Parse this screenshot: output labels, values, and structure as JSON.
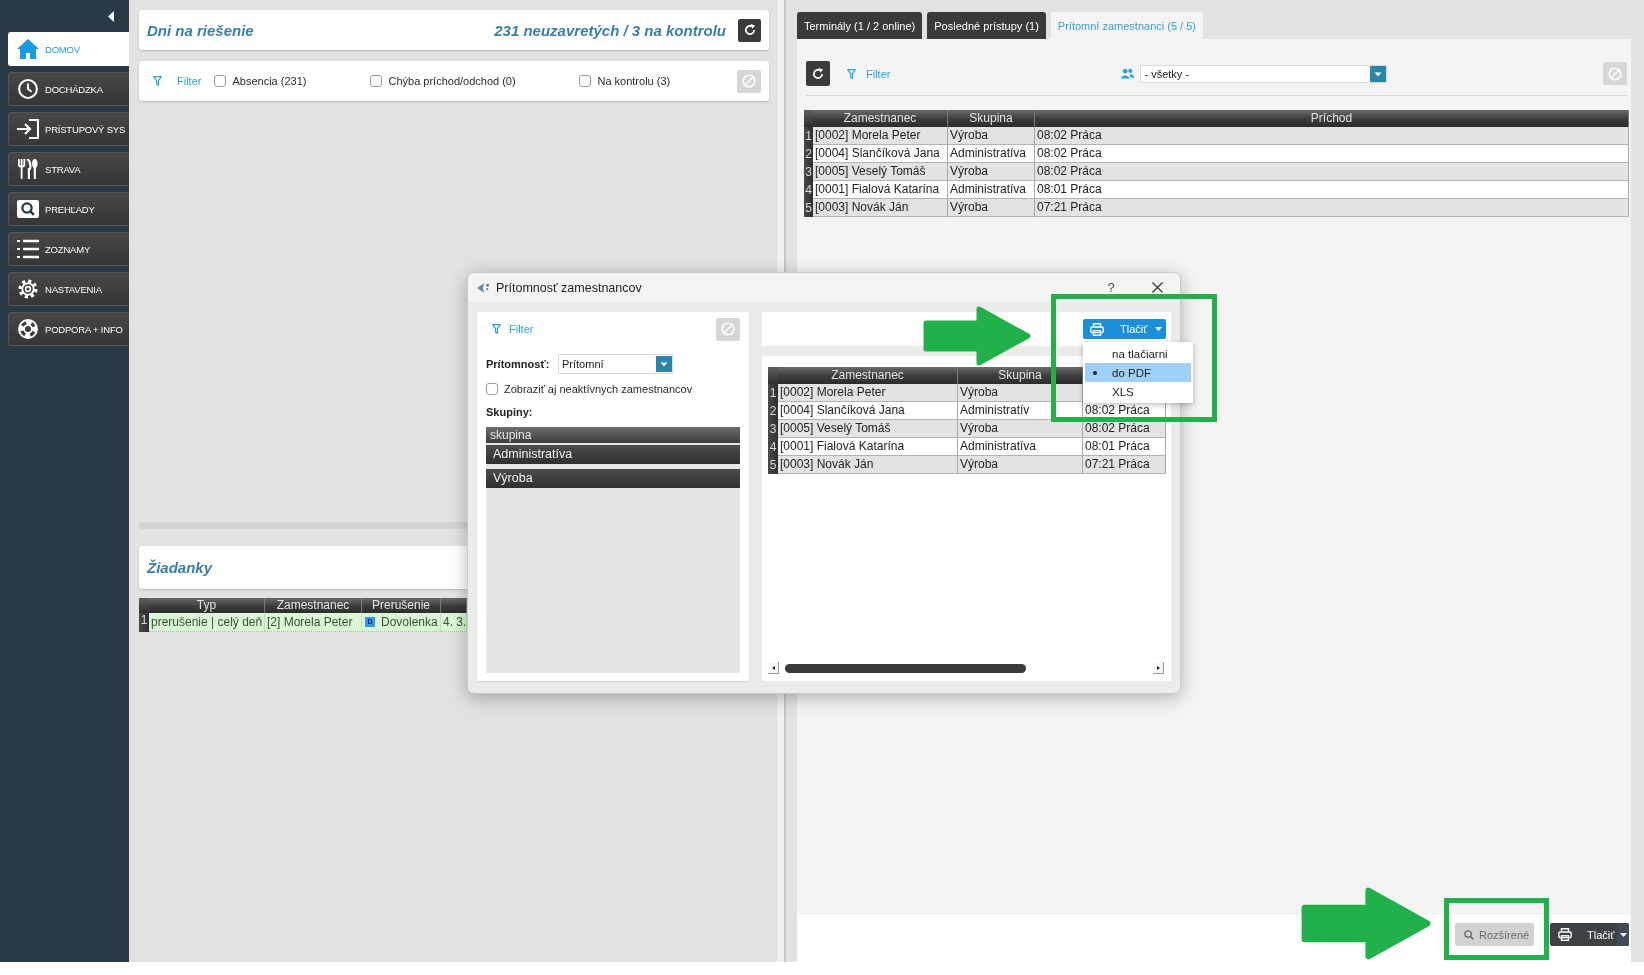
{
  "sidebar": {
    "items": [
      {
        "label": "DOMOV",
        "selected": true
      },
      {
        "label": "DOCHÁDZKA",
        "selected": false
      },
      {
        "label": "PRÍSTUPOVÝ SYS",
        "selected": false
      },
      {
        "label": "STRAVA",
        "selected": false
      },
      {
        "label": "PREHĽADY",
        "selected": false
      },
      {
        "label": "ZOZNAMY",
        "selected": false
      },
      {
        "label": "NASTAVENIA",
        "selected": false
      },
      {
        "label": "PODPORA + INFO",
        "selected": false
      }
    ]
  },
  "summary_card": {
    "title": "Dni na riešenie",
    "counts": "231 neuzavretých / 3 na kontrolu"
  },
  "filter_bar": {
    "filter": "Filter",
    "checkboxes": [
      {
        "label": "Absencia (231)",
        "checked": false
      },
      {
        "label": "Chýba príchod/odchod (0)",
        "checked": false
      },
      {
        "label": "Na kontrolu (3)",
        "checked": false
      }
    ],
    "clear_button": {
      "disabled": true
    }
  },
  "requests": {
    "title": "Žiadanky",
    "columns": [
      "Typ",
      "Zamestnanec",
      "Prerušenie"
    ],
    "rows": [
      {
        "number": "1",
        "color": "#dcf6d8",
        "type": "prerušenie | celý deň",
        "employee": "[2] Morela Peter",
        "absence_code": "D",
        "absence": "Dovolenka",
        "column_4": "4. 3."
      }
    ]
  },
  "tabs": [
    {
      "label": "Terminály (1 / 2 online)",
      "selected": false
    },
    {
      "label": "Posledné prístupy (1)",
      "selected": false
    },
    {
      "label": "Prítomní zamestnanci (5 / 5)",
      "selected": true
    }
  ],
  "presence_panel": {
    "filter": "Filter",
    "group_select": {
      "value": "- všetky -"
    },
    "clear_button": {
      "disabled": true
    },
    "table": {
      "columns": [
        "Zamestnanec",
        "Skupina",
        "Príchod"
      ],
      "rows": [
        {
          "number": "1",
          "cells": [
            "[0002] Morela Peter",
            "Výroba",
            "08:02 Práca"
          ]
        },
        {
          "number": "2",
          "cells": [
            "[0004] Slančíková Jana",
            "Administratíva",
            "08:02 Práca"
          ]
        },
        {
          "number": "3",
          "cells": [
            "[0005] Veselý Tomáš",
            "Výroba",
            "08:02 Práca"
          ]
        },
        {
          "number": "4",
          "cells": [
            "[0001] Fialová Katarína",
            "Administratíva",
            "08:01 Práca"
          ]
        },
        {
          "number": "5",
          "cells": [
            "[0003] Novák Ján",
            "Výroba",
            "07:21 Práca"
          ]
        }
      ]
    }
  },
  "bottom_bar": {
    "buttons": [
      {
        "kind": "search",
        "label": "Rozšírené",
        "disabled": true,
        "highlighted": true
      },
      {
        "kind": "print",
        "label": "Tlačiť",
        "disabled": false,
        "highlighted": false
      }
    ]
  },
  "dialog": {
    "title": "Prítomnosť zamestnancov",
    "help": "?",
    "filter": "Filter",
    "clear_button": {
      "disabled": true
    },
    "presence": {
      "label": "Prítomnosť:",
      "value": "Prítomní"
    },
    "inactive_checkbox": {
      "label": "Zobraziť aj neaktívnych zamestnancov",
      "checked": false
    },
    "groups": {
      "label": "Skupiny:",
      "header": "skupina",
      "items": [
        {
          "label": "Administratíva",
          "selected": false
        },
        {
          "label": "Výroba",
          "selected": false
        }
      ]
    },
    "print_button": {
      "label": "Tlačiť",
      "expanded": true,
      "highlighted": true
    },
    "print_menu": {
      "items": [
        {
          "label": "na tlačiarni",
          "selected": false
        },
        {
          "label": "do PDF",
          "selected": true
        },
        {
          "label": "XLS",
          "selected": false
        }
      ]
    },
    "table": {
      "columns": [
        "Zamestnanec",
        "Skupina"
      ],
      "rows": [
        {
          "number": "1",
          "cells": [
            "[0002] Morela Peter",
            "Výroba"
          ]
        },
        {
          "number": "2",
          "cells": [
            "[0004] Slančíková Jana",
            "Administratív",
            "08:02 Práca"
          ]
        },
        {
          "number": "3",
          "cells": [
            "[0005] Veselý Tomáš",
            "Výroba",
            "08:02 Práca"
          ]
        },
        {
          "number": "4",
          "cells": [
            "[0001] Fialová Katarína",
            "Administratíva",
            "08:01 Práca"
          ]
        },
        {
          "number": "5",
          "cells": [
            "[0003] Novák Ján",
            "Výroba",
            "07:21 Práca"
          ]
        }
      ]
    }
  }
}
